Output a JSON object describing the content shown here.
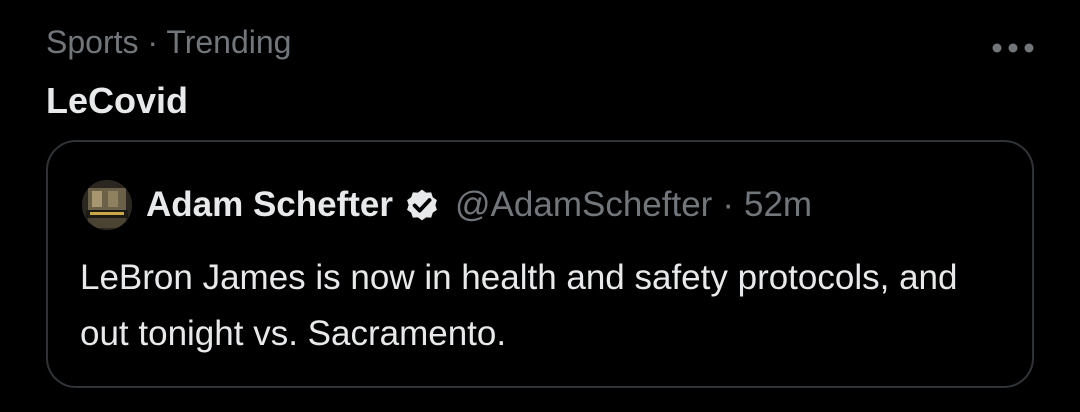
{
  "trend": {
    "context": "Sports · Trending",
    "topic": "LeCovid",
    "more_icon": "more-horizontal-icon"
  },
  "quoted_tweet": {
    "author_name": "Adam Schefter",
    "verified_icon": "verified-badge-icon",
    "handle": "@AdamSchefter",
    "separator": "·",
    "time": "52m",
    "text": "LeBron James is now in health and safety protocols, and out tonight vs. Sacramento."
  },
  "colors": {
    "background": "#000000",
    "primary_text": "#e7e9ea",
    "secondary_text": "#71767b",
    "border": "#2f3336"
  }
}
